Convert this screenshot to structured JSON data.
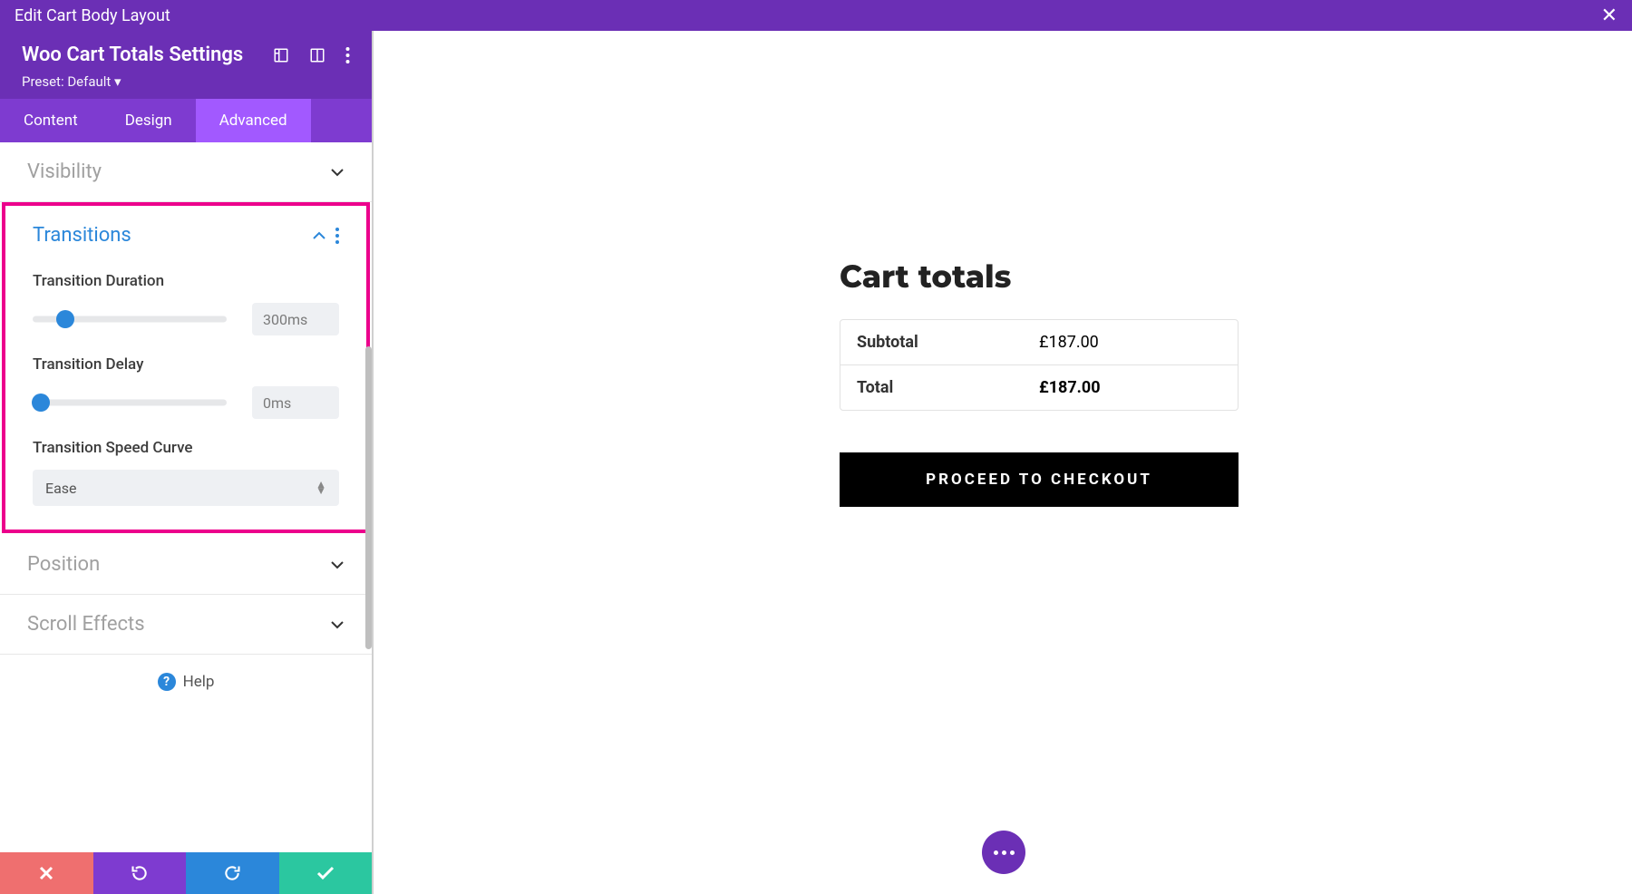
{
  "topBar": {
    "title": "Edit Cart Body Layout"
  },
  "sidebar": {
    "title": "Woo Cart Totals Settings",
    "preset": "Preset: Default ▾",
    "tabs": [
      "Content",
      "Design",
      "Advanced"
    ],
    "activeTab": 2,
    "sections": {
      "visibility": "Visibility",
      "transitions": "Transitions",
      "position": "Position",
      "scrollEffects": "Scroll Effects"
    },
    "transitions": {
      "durationLabel": "Transition Duration",
      "durationValue": "300ms",
      "durationThumbPercent": 17,
      "delayLabel": "Transition Delay",
      "delayValue": "0ms",
      "delayThumbPercent": 4,
      "speedCurveLabel": "Transition Speed Curve",
      "speedCurveValue": "Ease"
    },
    "help": "Help"
  },
  "cart": {
    "heading": "Cart totals",
    "subtotalLabel": "Subtotal",
    "subtotalValue": "£187.00",
    "totalLabel": "Total",
    "totalValue": "£187.00",
    "checkout": "PROCEED TO CHECKOUT"
  }
}
